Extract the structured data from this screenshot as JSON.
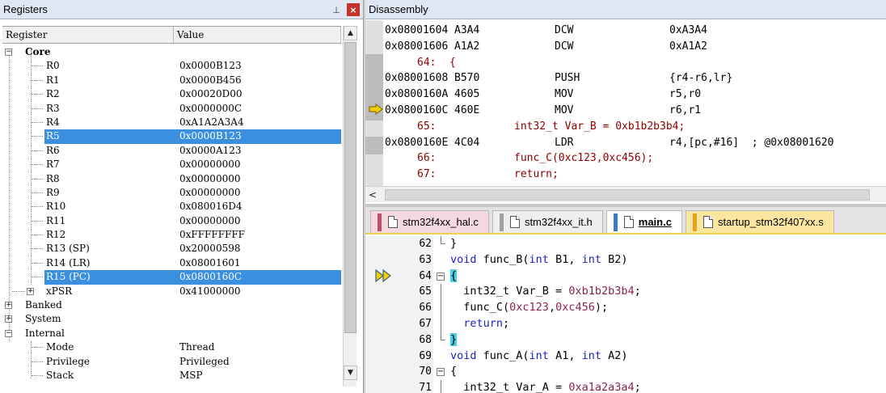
{
  "registers": {
    "title": "Registers",
    "pin_glyph": "⊥",
    "close_glyph": "×",
    "columns": {
      "register": "Register",
      "value": "Value"
    },
    "rows": [
      {
        "name": "Core",
        "value": "",
        "level": 0,
        "expander": "−",
        "bold": true
      },
      {
        "name": "R0",
        "value": "0x0000B123",
        "level": 2
      },
      {
        "name": "R1",
        "value": "0x0000B456",
        "level": 2
      },
      {
        "name": "R2",
        "value": "0x00020D00",
        "level": 2
      },
      {
        "name": "R3",
        "value": "0x0000000C",
        "level": 2
      },
      {
        "name": "R4",
        "value": "0xA1A2A3A4",
        "level": 2
      },
      {
        "name": "R5",
        "value": "0x0000B123",
        "level": 2,
        "selected": true
      },
      {
        "name": "R6",
        "value": "0x0000A123",
        "level": 2
      },
      {
        "name": "R7",
        "value": "0x00000000",
        "level": 2
      },
      {
        "name": "R8",
        "value": "0x00000000",
        "level": 2
      },
      {
        "name": "R9",
        "value": "0x00000000",
        "level": 2
      },
      {
        "name": "R10",
        "value": "0x080016D4",
        "level": 2
      },
      {
        "name": "R11",
        "value": "0x00000000",
        "level": 2
      },
      {
        "name": "R12",
        "value": "0xFFFFFFFF",
        "level": 2
      },
      {
        "name": "R13 (SP)",
        "value": "0x20000598",
        "level": 2
      },
      {
        "name": "R14 (LR)",
        "value": "0x08001601",
        "level": 2
      },
      {
        "name": "R15 (PC)",
        "value": "0x0800160C",
        "level": 2,
        "selected": true
      },
      {
        "name": "xPSR",
        "value": "0x41000000",
        "level": 1,
        "expander": "+"
      },
      {
        "name": "Banked",
        "value": "",
        "level": 0,
        "expander": "+"
      },
      {
        "name": "System",
        "value": "",
        "level": 0,
        "expander": "+"
      },
      {
        "name": "Internal",
        "value": "",
        "level": 0,
        "expander": "−"
      },
      {
        "name": "Mode",
        "value": "Thread",
        "level": 2
      },
      {
        "name": "Privilege",
        "value": "Privileged",
        "level": 2
      },
      {
        "name": "Stack",
        "value": "MSP",
        "level": 2
      }
    ],
    "scroll_up": "▲",
    "scroll_down": "▼"
  },
  "disassembly": {
    "title": "Disassembly",
    "lines": [
      {
        "kind": "ins",
        "addr": "0x08001604",
        "code": "A3A4",
        "mnem": "DCW",
        "ops": "0xA3A4"
      },
      {
        "kind": "ins",
        "addr": "0x08001606",
        "code": "A1A2",
        "mnem": "DCW",
        "ops": "0xA1A2"
      },
      {
        "kind": "src",
        "lineno": "64:",
        "text": "{"
      },
      {
        "kind": "ins",
        "addr": "0x08001608",
        "code": "B570",
        "mnem": "PUSH",
        "ops": "{r4-r6,lr}"
      },
      {
        "kind": "ins",
        "addr": "0x0800160A",
        "code": "4605",
        "mnem": "MOV",
        "ops": "r5,r0"
      },
      {
        "kind": "ins",
        "addr": "0x0800160C",
        "code": "460E",
        "mnem": "MOV",
        "ops": "r6,r1",
        "current": true
      },
      {
        "kind": "src",
        "lineno": "65:",
        "text": "int32_t Var_B = 0xb1b2b3b4;"
      },
      {
        "kind": "ins",
        "addr": "0x0800160E",
        "code": "4C04",
        "mnem": "LDR",
        "ops": "r4,[pc,#16]  ; @0x08001620"
      },
      {
        "kind": "src",
        "lineno": "66:",
        "text": "func_C(0xc123,0xc456);"
      },
      {
        "kind": "src",
        "lineno": "67:",
        "text": "return;"
      }
    ],
    "scroll_left": "<"
  },
  "editor": {
    "tabs": [
      {
        "label": "stm32f4xx_hal.c",
        "style": "hal",
        "accent": "#c0506a"
      },
      {
        "label": "stm32f4xx_it.h",
        "style": "it",
        "accent": "#a0a0a0"
      },
      {
        "label": "main.c",
        "style": "main",
        "accent": "#3a78c8"
      },
      {
        "label": "startup_stm32f407xx.s",
        "style": "startup",
        "accent": "#e8a020"
      }
    ],
    "lines": [
      {
        "ln": "62",
        "fold": "end",
        "parts": [
          {
            "t": "}",
            "c": ""
          }
        ]
      },
      {
        "ln": "63",
        "fold": "",
        "parts": [
          {
            "t": "void",
            "c": "kw"
          },
          {
            "t": " func_B(",
            "c": ""
          },
          {
            "t": "int",
            "c": "kw"
          },
          {
            "t": " B1, ",
            "c": ""
          },
          {
            "t": "int",
            "c": "kw"
          },
          {
            "t": " B2)",
            "c": ""
          }
        ]
      },
      {
        "ln": "64",
        "fold": "open",
        "parts": [
          {
            "t": "{",
            "c": "brace-hl"
          }
        ]
      },
      {
        "ln": "65",
        "fold": "line",
        "parts": [
          {
            "t": "  int32_t Var_B = ",
            "c": ""
          },
          {
            "t": "0xb1b2b3b4",
            "c": "num"
          },
          {
            "t": ";",
            "c": ""
          }
        ]
      },
      {
        "ln": "66",
        "fold": "line",
        "parts": [
          {
            "t": "  func_C(",
            "c": ""
          },
          {
            "t": "0xc123",
            "c": "num"
          },
          {
            "t": ",",
            "c": ""
          },
          {
            "t": "0xc456",
            "c": "num"
          },
          {
            "t": ");",
            "c": ""
          }
        ]
      },
      {
        "ln": "67",
        "fold": "line",
        "parts": [
          {
            "t": "  return",
            "c": "kw"
          },
          {
            "t": ";",
            "c": ""
          }
        ]
      },
      {
        "ln": "68",
        "fold": "end",
        "parts": [
          {
            "t": "}",
            "c": "brace-hl"
          }
        ]
      },
      {
        "ln": "69",
        "fold": "",
        "parts": [
          {
            "t": "void",
            "c": "kw"
          },
          {
            "t": " func_A(",
            "c": ""
          },
          {
            "t": "int",
            "c": "kw"
          },
          {
            "t": " A1, ",
            "c": ""
          },
          {
            "t": "int",
            "c": "kw"
          },
          {
            "t": " A2)",
            "c": ""
          }
        ]
      },
      {
        "ln": "70",
        "fold": "open",
        "parts": [
          {
            "t": "{",
            "c": ""
          }
        ]
      },
      {
        "ln": "71",
        "fold": "line",
        "parts": [
          {
            "t": "  int32_t Var_A = ",
            "c": ""
          },
          {
            "t": "0xa1a2a3a4",
            "c": "num"
          },
          {
            "t": ";",
            "c": ""
          }
        ]
      }
    ]
  },
  "colors": {
    "selection": "#3a8fde",
    "source_line": "#8b0000",
    "keyword": "#2020c0",
    "number": "#8b2252",
    "brace_highlight": "#48d1e8",
    "exec_arrow": "#f0d000"
  }
}
